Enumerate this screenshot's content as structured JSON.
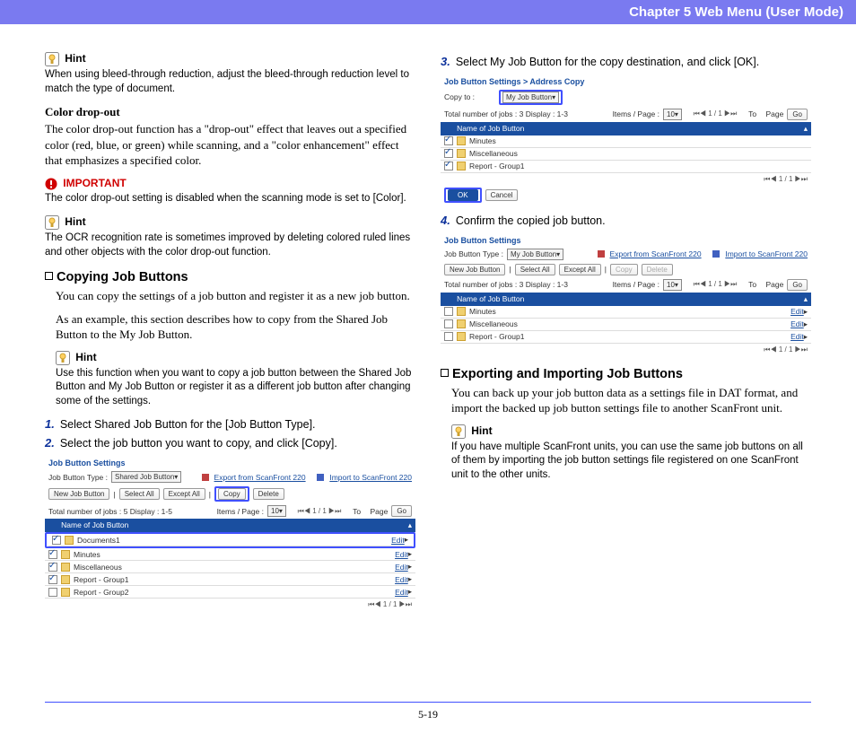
{
  "header": {
    "title": "Chapter 5   Web Menu (User Mode)"
  },
  "left": {
    "hint1_label": "Hint",
    "hint1_body": "When using bleed-through reduction, adjust the bleed-through reduction level to match the type of document.",
    "colordrop_title": "Color drop-out",
    "colordrop_body": "The color drop-out function has a \"drop-out\" effect that leaves out a specified color (red, blue, or green) while scanning, and a \"color enhancement\" effect that emphasizes a specified color.",
    "important_label": "IMPORTANT",
    "important_body": "The color drop-out setting is disabled when the scanning mode is set to [Color].",
    "hint2_label": "Hint",
    "hint2_body": "The OCR recognition rate is sometimes improved by deleting colored ruled lines and other objects with the color drop-out function.",
    "copying_head": "Copying Job Buttons",
    "copying_p1": "You can copy the settings of a job button and register it as a new job button.",
    "copying_p2": "As an example, this section describes how to copy from the Shared Job Button to the My Job Button.",
    "hint3_label": "Hint",
    "hint3_body": "Use this function when you want to copy a job button between the Shared Job Button and My Job Button or register it as a different job button after changing some of the settings.",
    "step1": "Select Shared Job Button for the [Job Button Type].",
    "step2": "Select the job button you want to copy, and click [Copy].",
    "fig1": {
      "title": "Job Button Settings",
      "type_label": "Job Button Type :",
      "type_value": "Shared Job Button",
      "export": "Export from ScanFront 220",
      "import": "Import to ScanFront 220",
      "new_btn": "New Job Button",
      "select_all": "Select All",
      "except_all": "Except All",
      "copy": "Copy",
      "delete": "Delete",
      "totals": "Total number of jobs : 5  Display : 1-5",
      "items_page": "Items / Page :",
      "items_val": "10",
      "pager": "1 / 1",
      "to": "To",
      "page": "Page",
      "go": "Go",
      "thead": "Name of Job Button",
      "rows": [
        {
          "name": "Documents1",
          "edit": "Edit"
        },
        {
          "name": "Minutes",
          "edit": "Edit"
        },
        {
          "name": "Miscellaneous",
          "edit": "Edit"
        },
        {
          "name": "Report - Group1",
          "edit": "Edit"
        },
        {
          "name": "Report - Group2",
          "edit": "Edit"
        }
      ]
    }
  },
  "right": {
    "step3": "Select My Job Button for the copy destination, and click [OK].",
    "fig2": {
      "title": "Job Button Settings > Address Copy",
      "copyto": "Copy to :",
      "copyto_val": "My Job Button",
      "totals": "Total number of jobs : 3  Display : 1-3",
      "items_page": "Items / Page :",
      "items_val": "10",
      "pager": "1 / 1",
      "to": "To",
      "page": "Page",
      "go": "Go",
      "thead": "Name of Job Button",
      "rows": [
        {
          "name": "Minutes"
        },
        {
          "name": "Miscellaneous"
        },
        {
          "name": "Report - Group1"
        }
      ],
      "ok": "OK",
      "cancel": "Cancel"
    },
    "step4": "Confirm the copied job button.",
    "fig3": {
      "title": "Job Button Settings",
      "type_label": "Job Button Type :",
      "type_value": "My Job Button",
      "export": "Export from ScanFront 220",
      "import": "Import to ScanFront 220",
      "new_btn": "New Job Button",
      "select_all": "Select All",
      "except_all": "Except All",
      "copy": "Copy",
      "delete": "Delete",
      "totals": "Total number of jobs : 3  Display : 1-3",
      "items_page": "Items / Page :",
      "items_val": "10",
      "pager": "1 / 1",
      "to": "To",
      "page": "Page",
      "go": "Go",
      "thead": "Name of Job Button",
      "rows": [
        {
          "name": "Minutes",
          "edit": "Edit"
        },
        {
          "name": "Miscellaneous",
          "edit": "Edit"
        },
        {
          "name": "Report - Group1",
          "edit": "Edit"
        }
      ]
    },
    "export_head": "Exporting and Importing Job Buttons",
    "export_body": "You can back up your job button data as a settings file in DAT format, and import the backed up job button settings file to another ScanFront unit.",
    "hint4_label": "Hint",
    "hint4_body": "If you have multiple ScanFront units, you can use the same job buttons on all of them by importing the job button settings file registered on one ScanFront unit to the other units."
  },
  "footer": {
    "page": "5-19"
  }
}
